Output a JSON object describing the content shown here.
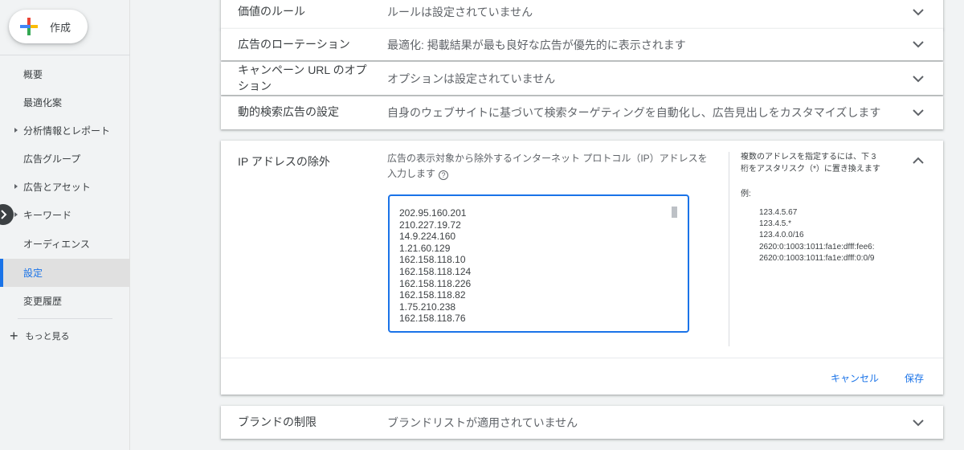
{
  "sidebar": {
    "create_label": "作成",
    "items": [
      {
        "label": "概要"
      },
      {
        "label": "最適化案"
      },
      {
        "label": "分析情報とレポート"
      },
      {
        "label": "広告グループ"
      },
      {
        "label": "広告とアセット"
      },
      {
        "label": "キーワード"
      },
      {
        "label": "オーディエンス"
      },
      {
        "label": "設定"
      },
      {
        "label": "変更履歴"
      }
    ],
    "more_label": "もっと見る"
  },
  "settings": {
    "rows": [
      {
        "title": "価値のルール",
        "value": "ルールは設定されていません"
      },
      {
        "title": "広告のローテーション",
        "value": "最適化: 掲載結果が最も良好な広告が優先的に表示されます"
      },
      {
        "title_line1": "キャンペーン URL のオプ",
        "title_line2": "ション",
        "value": "オプションは設定されていません"
      },
      {
        "title": "動的検索広告の設定",
        "value": "自身のウェブサイトに基づいて検索ターゲティングを自動化し、広告見出しをカスタマイズします"
      }
    ],
    "ip_exclusion": {
      "title": "IP アドレスの除外",
      "description_line1": "広告の表示対象から除外するインターネット プロトコル（IP）アドレスを",
      "description_line2": "入力します",
      "addresses": [
        "202.95.160.201",
        "210.227.19.72",
        "14.9.224.160",
        "1.21.60.129",
        "162.158.118.10",
        "162.158.118.124",
        "162.158.118.226",
        "162.158.118.82",
        "1.75.210.238",
        "162.158.118.76"
      ],
      "help_line1": "複数のアドレスを指定するには、下 3",
      "help_line2": "桁をアスタリスク（*）に置き換えます",
      "example_label": "例:",
      "examples": [
        "123.4.5.67",
        "123.4.5.*",
        "123.4.0.0/16",
        "2620:0:1003:1011:fa1e:dfff:fee6:",
        "2620:0:1003:1011:fa1e:dfff:0:0/9"
      ],
      "cancel_label": "キャンセル",
      "save_label": "保存"
    },
    "brand_row": {
      "title": "ブランドの制限",
      "value": "ブランドリストが適用されていません"
    }
  },
  "colors": {
    "accent": "#1a73e8",
    "text": "#3c4043",
    "muted": "#5f6368"
  }
}
